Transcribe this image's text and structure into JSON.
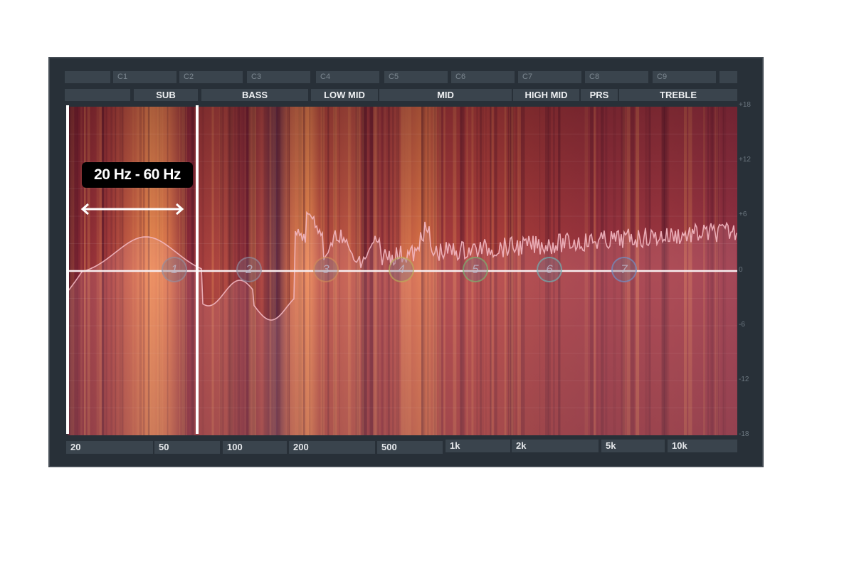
{
  "notes": [
    "",
    "C1",
    "C2",
    "C3",
    "C4",
    "C5",
    "C6",
    "C7",
    "C8",
    "C9",
    ""
  ],
  "bands": [
    "",
    "SUB",
    "BASS",
    "LOW MID",
    "MID",
    "HIGH MID",
    "PRS",
    "TREBLE"
  ],
  "freq_labels": [
    "20",
    "50",
    "100",
    "200",
    "500",
    "1k",
    "2k",
    "5k",
    "10k"
  ],
  "db_labels": [
    "+18",
    "+12",
    "+6",
    "0",
    "-6",
    "-12",
    "-18"
  ],
  "selection": {
    "range_label": "20 Hz - 60 Hz",
    "low_hz": 20,
    "high_hz": 60
  },
  "nodes": [
    {
      "label": "1",
      "color": "#9aa0c8"
    },
    {
      "label": "2",
      "color": "#9aa0c8"
    },
    {
      "label": "3",
      "color": "#e0a050"
    },
    {
      "label": "4",
      "color": "#c8c050"
    },
    {
      "label": "5",
      "color": "#7cc070"
    },
    {
      "label": "6",
      "color": "#70c0c0"
    },
    {
      "label": "7",
      "color": "#7090d0"
    }
  ],
  "colors": {
    "panel": "#283038",
    "spectrum_dark": "#6a1f33",
    "spectrum_hot": "#f08a4e",
    "curve": "#f3b8c2"
  }
}
